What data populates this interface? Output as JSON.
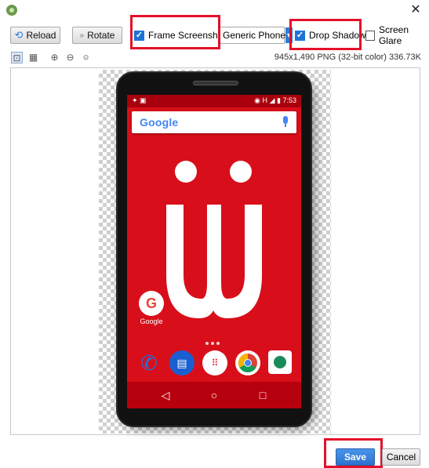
{
  "window": {
    "app_icon": "android-studio-icon",
    "close_label": "✕"
  },
  "toolbar": {
    "reload_label": "Reload",
    "rotate_label": "Rotate",
    "frame_screenshot_label": "Frame Screenshot",
    "frame_screenshot_checked": true,
    "device_select_value": "Generic Phone",
    "drop_shadow_label": "Drop Shadow",
    "drop_shadow_checked": true,
    "screen_glare_label": "Screen Glare",
    "screen_glare_checked": false
  },
  "view": {
    "icons": [
      "fit-icon",
      "grid-icon",
      "zoom-in-icon",
      "zoom-out-icon",
      "actual-size-icon"
    ],
    "image_info": "945x1,490 PNG (32-bit color) 336.73K"
  },
  "phone": {
    "status_time": "7:53",
    "status_network": "H",
    "search_brand": "Google",
    "home_app_label": "Google"
  },
  "footer": {
    "save_label": "Save",
    "cancel_label": "Cancel"
  },
  "colors": {
    "highlight": "#e2102a",
    "accent": "#2c72cc",
    "screen_bg": "#d80f1a"
  }
}
